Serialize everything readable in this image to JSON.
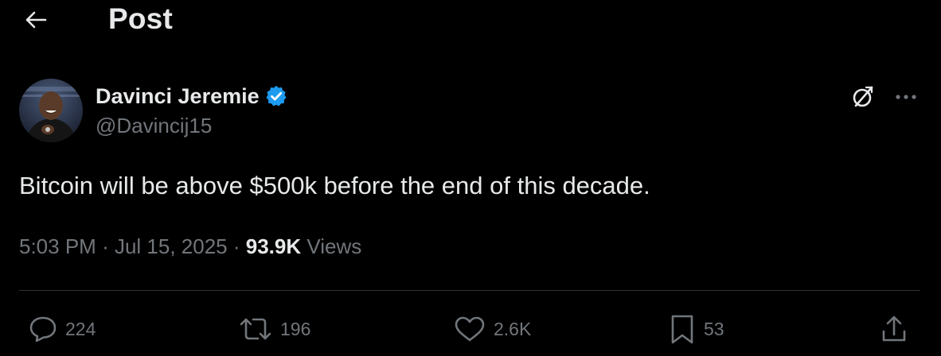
{
  "header": {
    "title": "Post",
    "back_icon": "arrow-left-icon"
  },
  "author": {
    "name": "Davinci Jeremie",
    "handle": "@Davincij15",
    "verified_icon": "verified-badge-icon",
    "verified_color": "#1d9bf0"
  },
  "tweet": {
    "text": "Bitcoin will be above $500k before the end of this decade."
  },
  "meta": {
    "time": "5:03 PM",
    "separator": "·",
    "date": "Jul 15, 2025",
    "views_count": "93.9K",
    "views_label": "Views"
  },
  "actions": {
    "replies": "224",
    "reposts": "196",
    "likes": "2.6K",
    "bookmarks": "53"
  },
  "colors": {
    "background": "#000000",
    "primary_text": "#e7e9ea",
    "secondary_text": "#71767b",
    "divider": "#2f3336",
    "accent": "#1d9bf0"
  }
}
